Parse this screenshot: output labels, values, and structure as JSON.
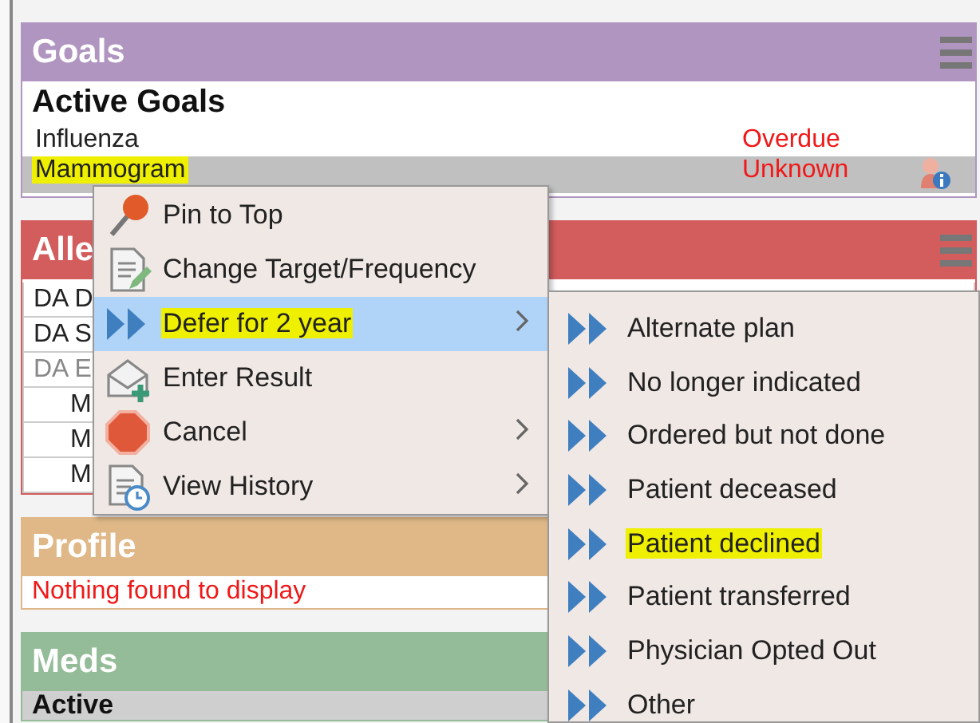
{
  "goals": {
    "title": "Goals",
    "menu_button": true,
    "subtitle": "Active Goals",
    "rows": [
      {
        "name": "Influenza",
        "status": "Overdue",
        "info": false,
        "selected": false,
        "highlighted": false
      },
      {
        "name": "Mammogram",
        "status": "Unknown",
        "info": true,
        "selected": true,
        "highlighted": true
      }
    ]
  },
  "allergies": {
    "title": "Alle",
    "menu_button": true,
    "rows": [
      {
        "text": "DA D",
        "kind": "entry",
        "inactive": false
      },
      {
        "text": "DA S",
        "kind": "entry",
        "inactive": false
      },
      {
        "text": "DA E",
        "kind": "entry",
        "inactive": true
      },
      {
        "text": "M",
        "kind": "sub",
        "inactive": false
      },
      {
        "text": "M",
        "kind": "sub",
        "inactive": false
      },
      {
        "text": "M",
        "kind": "sub",
        "inactive": false
      }
    ]
  },
  "profile": {
    "title": "Profile",
    "message": "Nothing found to display"
  },
  "meds": {
    "title": "Meds",
    "subtitle": "Active"
  },
  "context_menu": {
    "items": [
      {
        "label": "Pin to Top",
        "kind": "pin",
        "submenu": false,
        "selected": false,
        "highlighted": false
      },
      {
        "label": "Change Target/Frequency",
        "kind": "document-pencil",
        "submenu": false,
        "selected": false,
        "highlighted": false
      },
      {
        "label": "Defer for 2 year",
        "kind": "double-arrow",
        "submenu": true,
        "selected": true,
        "highlighted": true
      },
      {
        "label": "Enter Result",
        "kind": "envelope-plus",
        "submenu": false,
        "selected": false,
        "highlighted": false
      },
      {
        "label": "Cancel",
        "kind": "stop",
        "submenu": true,
        "selected": false,
        "highlighted": false
      },
      {
        "label": "View History",
        "kind": "document-clock",
        "submenu": true,
        "selected": false,
        "highlighted": false
      }
    ]
  },
  "submenu": {
    "items": [
      {
        "label": "Alternate plan",
        "kind": "double-arrow",
        "highlighted": false
      },
      {
        "label": "No longer indicated",
        "kind": "double-arrow",
        "highlighted": false
      },
      {
        "label": "Ordered but not done",
        "kind": "double-arrow",
        "highlighted": false
      },
      {
        "label": "Patient deceased",
        "kind": "double-arrow",
        "highlighted": false
      },
      {
        "label": "Patient declined",
        "kind": "double-arrow",
        "highlighted": true
      },
      {
        "label": "Patient transferred",
        "kind": "double-arrow",
        "highlighted": false
      },
      {
        "label": "Physician Opted Out",
        "kind": "double-arrow",
        "highlighted": false
      },
      {
        "label": "Other",
        "kind": "double-arrow",
        "highlighted": false
      }
    ]
  }
}
